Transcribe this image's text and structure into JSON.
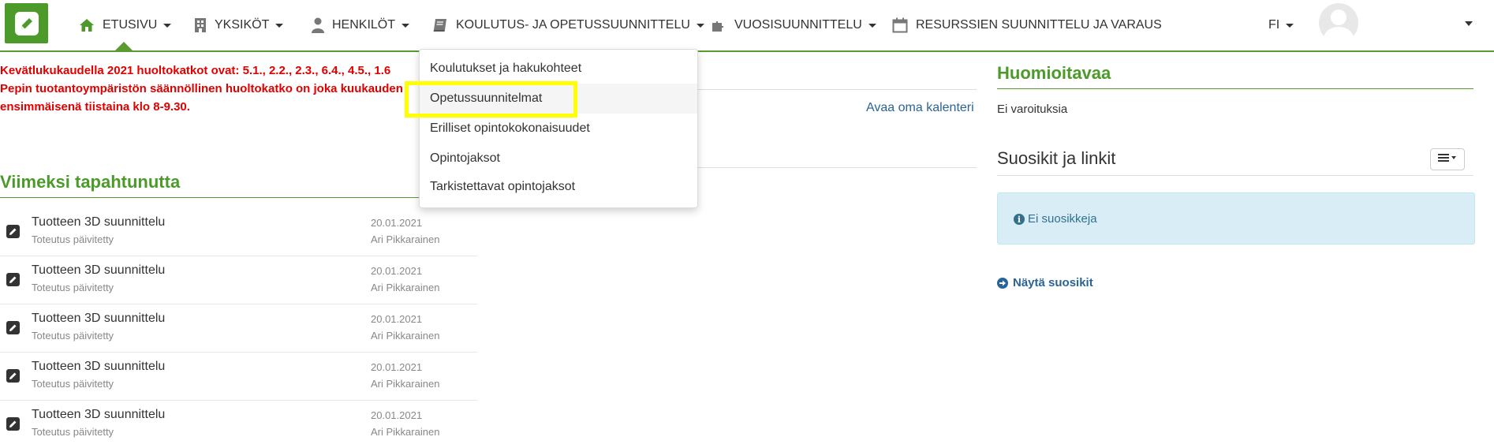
{
  "nav": {
    "items": [
      {
        "label": "ETUSIVU",
        "icon": "home-icon"
      },
      {
        "label": "YKSIKÖT",
        "icon": "building-icon"
      },
      {
        "label": "HENKILÖT",
        "icon": "person-icon"
      },
      {
        "label": "KOULUTUS- JA OPETUSSUUNNITTELU",
        "icon": "book-icon"
      },
      {
        "label": "VUOSISUUNNITTELU",
        "icon": "puzzle-icon"
      },
      {
        "label": "RESURSSIEN SUUNNITTELU JA VARAUS",
        "icon": "calendar-icon"
      }
    ],
    "language": "FI"
  },
  "notice": {
    "lines": [
      "Kevätlukukaudella 2021 huoltokatkot ovat: 5.1., 2.2., 2.3., 6.4., 4.5., 1.6",
      "Pepin tuotantoympäristön säännöllinen huoltokatko on joka kuukauden",
      "ensimmäisenä tiistaina klo 8-9.30."
    ]
  },
  "recent": {
    "title": "Viimeksi tapahtunutta",
    "items": [
      {
        "title": "Tuotteen 3D suunnittelu",
        "sub": "Toteutus päivitetty",
        "date": "20.01.2021",
        "author": "Ari Pikkarainen"
      },
      {
        "title": "Tuotteen 3D suunnittelu",
        "sub": "Toteutus päivitetty",
        "date": "20.01.2021",
        "author": "Ari Pikkarainen"
      },
      {
        "title": "Tuotteen 3D suunnittelu",
        "sub": "Toteutus päivitetty",
        "date": "20.01.2021",
        "author": "Ari Pikkarainen"
      },
      {
        "title": "Tuotteen 3D suunnittelu",
        "sub": "Toteutus päivitetty",
        "date": "20.01.2021",
        "author": "Ari Pikkarainen"
      },
      {
        "title": "Tuotteen 3D suunnittelu",
        "sub": "Toteutus päivitetty",
        "date": "20.01.2021",
        "author": "Ari Pikkarainen"
      }
    ]
  },
  "calendar": {
    "link": "Avaa oma kalenteri"
  },
  "notes": {
    "title": "Huomioitavaa",
    "text": "Ei varoituksia"
  },
  "favorites": {
    "title": "Suosikit ja linkit",
    "empty": "Ei suosikkeja",
    "show": "Näytä suosikit"
  },
  "dropdown": {
    "items": [
      "Koulutukset ja hakukohteet",
      "Opetussuunnitelmat",
      "Erilliset opintokokonaisuudet",
      "Opintojaksot",
      "Tarkistettavat opintojaksot"
    ]
  },
  "colors": {
    "brand": "#4c9a2a",
    "notice": "#e00000",
    "link": "#2a6496",
    "highlight": "#ffff00"
  }
}
